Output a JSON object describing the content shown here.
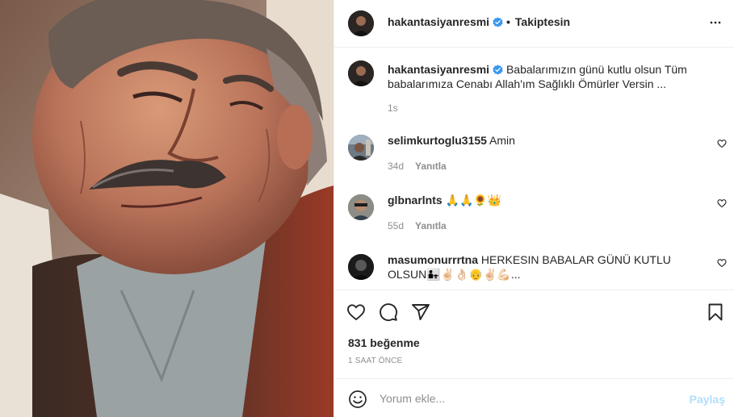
{
  "post": {
    "username": "hakantasiyanresmi",
    "follow_status": "Takiptesin",
    "separator": "•"
  },
  "caption": {
    "username": "hakantasiyanresmi",
    "text": " Babalarımızın günü kutlu olsun Tüm babalarımıza Cenabı Allah'ım Sağlıklı Ömürler Versin ...",
    "time": "1s"
  },
  "comments": [
    {
      "username": "selimkurtoglu3155",
      "text": " Amin",
      "age": "34d",
      "reply_label": "Yanıtla"
    },
    {
      "username": "glbnarlnts",
      "text": " 🙏🙏🌻👑",
      "age": "55d",
      "reply_label": "Yanıtla"
    },
    {
      "username": "masumonurrrtna",
      "text": " HERKESIN BABALAR GÜNÜ KUTLU OLSUN👨‍👧✌🏻👌🏻👴✌🏻💪🏻...",
      "age": "",
      "reply_label": ""
    }
  ],
  "stats": {
    "likes": "831 beğenme",
    "posted_ago": "1 SAAT ÖNCE"
  },
  "comment_box": {
    "placeholder": "Yorum ekle...",
    "post_label": "Paylaş"
  },
  "icons": {
    "verified": "verified-badge-icon",
    "more": "more-options-icon",
    "like": "heart-icon",
    "comment": "comment-icon",
    "share": "share-icon",
    "save": "bookmark-icon",
    "emoji": "emoji-icon"
  },
  "colors": {
    "verified_blue": "#3897f0",
    "muted_text": "#8e8e8e",
    "post_button_disabled": "#b2dffc",
    "divider": "#efefef"
  }
}
